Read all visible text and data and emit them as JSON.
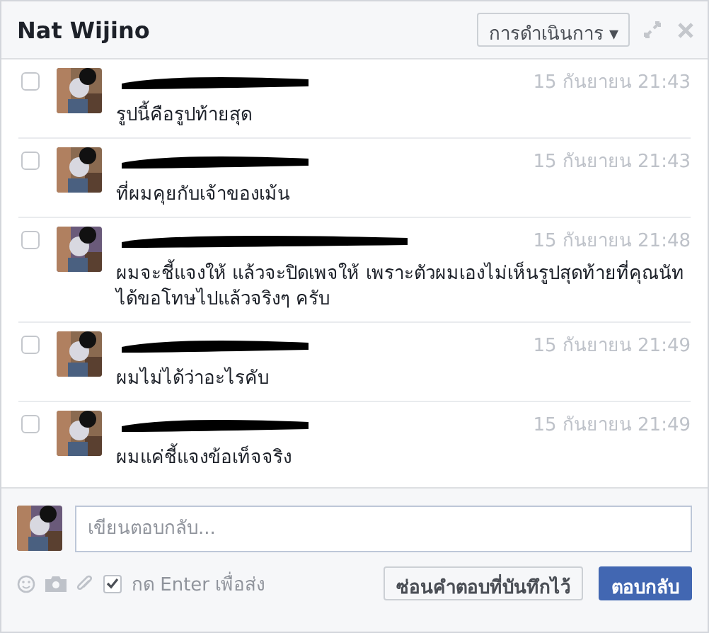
{
  "window": {
    "title": "Nat Wijino",
    "actions_button": "การดำเนินการ ▾"
  },
  "messages": [
    {
      "selected": false,
      "time": "15 กันยายน 21:43",
      "text": "รูปนี้คือรูปท้ายสุด"
    },
    {
      "selected": false,
      "time": "15 กันยายน 21:43",
      "text": "ที่ผมคุยกับเจ้าของเม้น"
    },
    {
      "selected": false,
      "time": "15 กันยายน 21:48",
      "text": "ผมจะชี้แจงให้ แล้วจะปิดเพจให้ เพราะตัวผมเองไม่เห็นรูปสุดท้ายที่คุณนัทได้ขอโทษไปแล้วจริงๆ ครับ"
    },
    {
      "selected": false,
      "time": "15 กันยายน 21:49",
      "text": "ผมไม่ได้ว่าอะไรคับ"
    },
    {
      "selected": false,
      "time": "15 กันยายน 21:49",
      "text": "ผมแค่ชี้แจงข้อเท็จจริง"
    }
  ],
  "composer": {
    "placeholder": "เขียนตอบกลับ...",
    "enter_to_send": {
      "label": "กด Enter เพื่อส่ง",
      "checked": true
    },
    "hide_saved_button": "ซ่อนคำตอบที่บันทึกไว้",
    "reply_button": "ตอบกลับ"
  }
}
